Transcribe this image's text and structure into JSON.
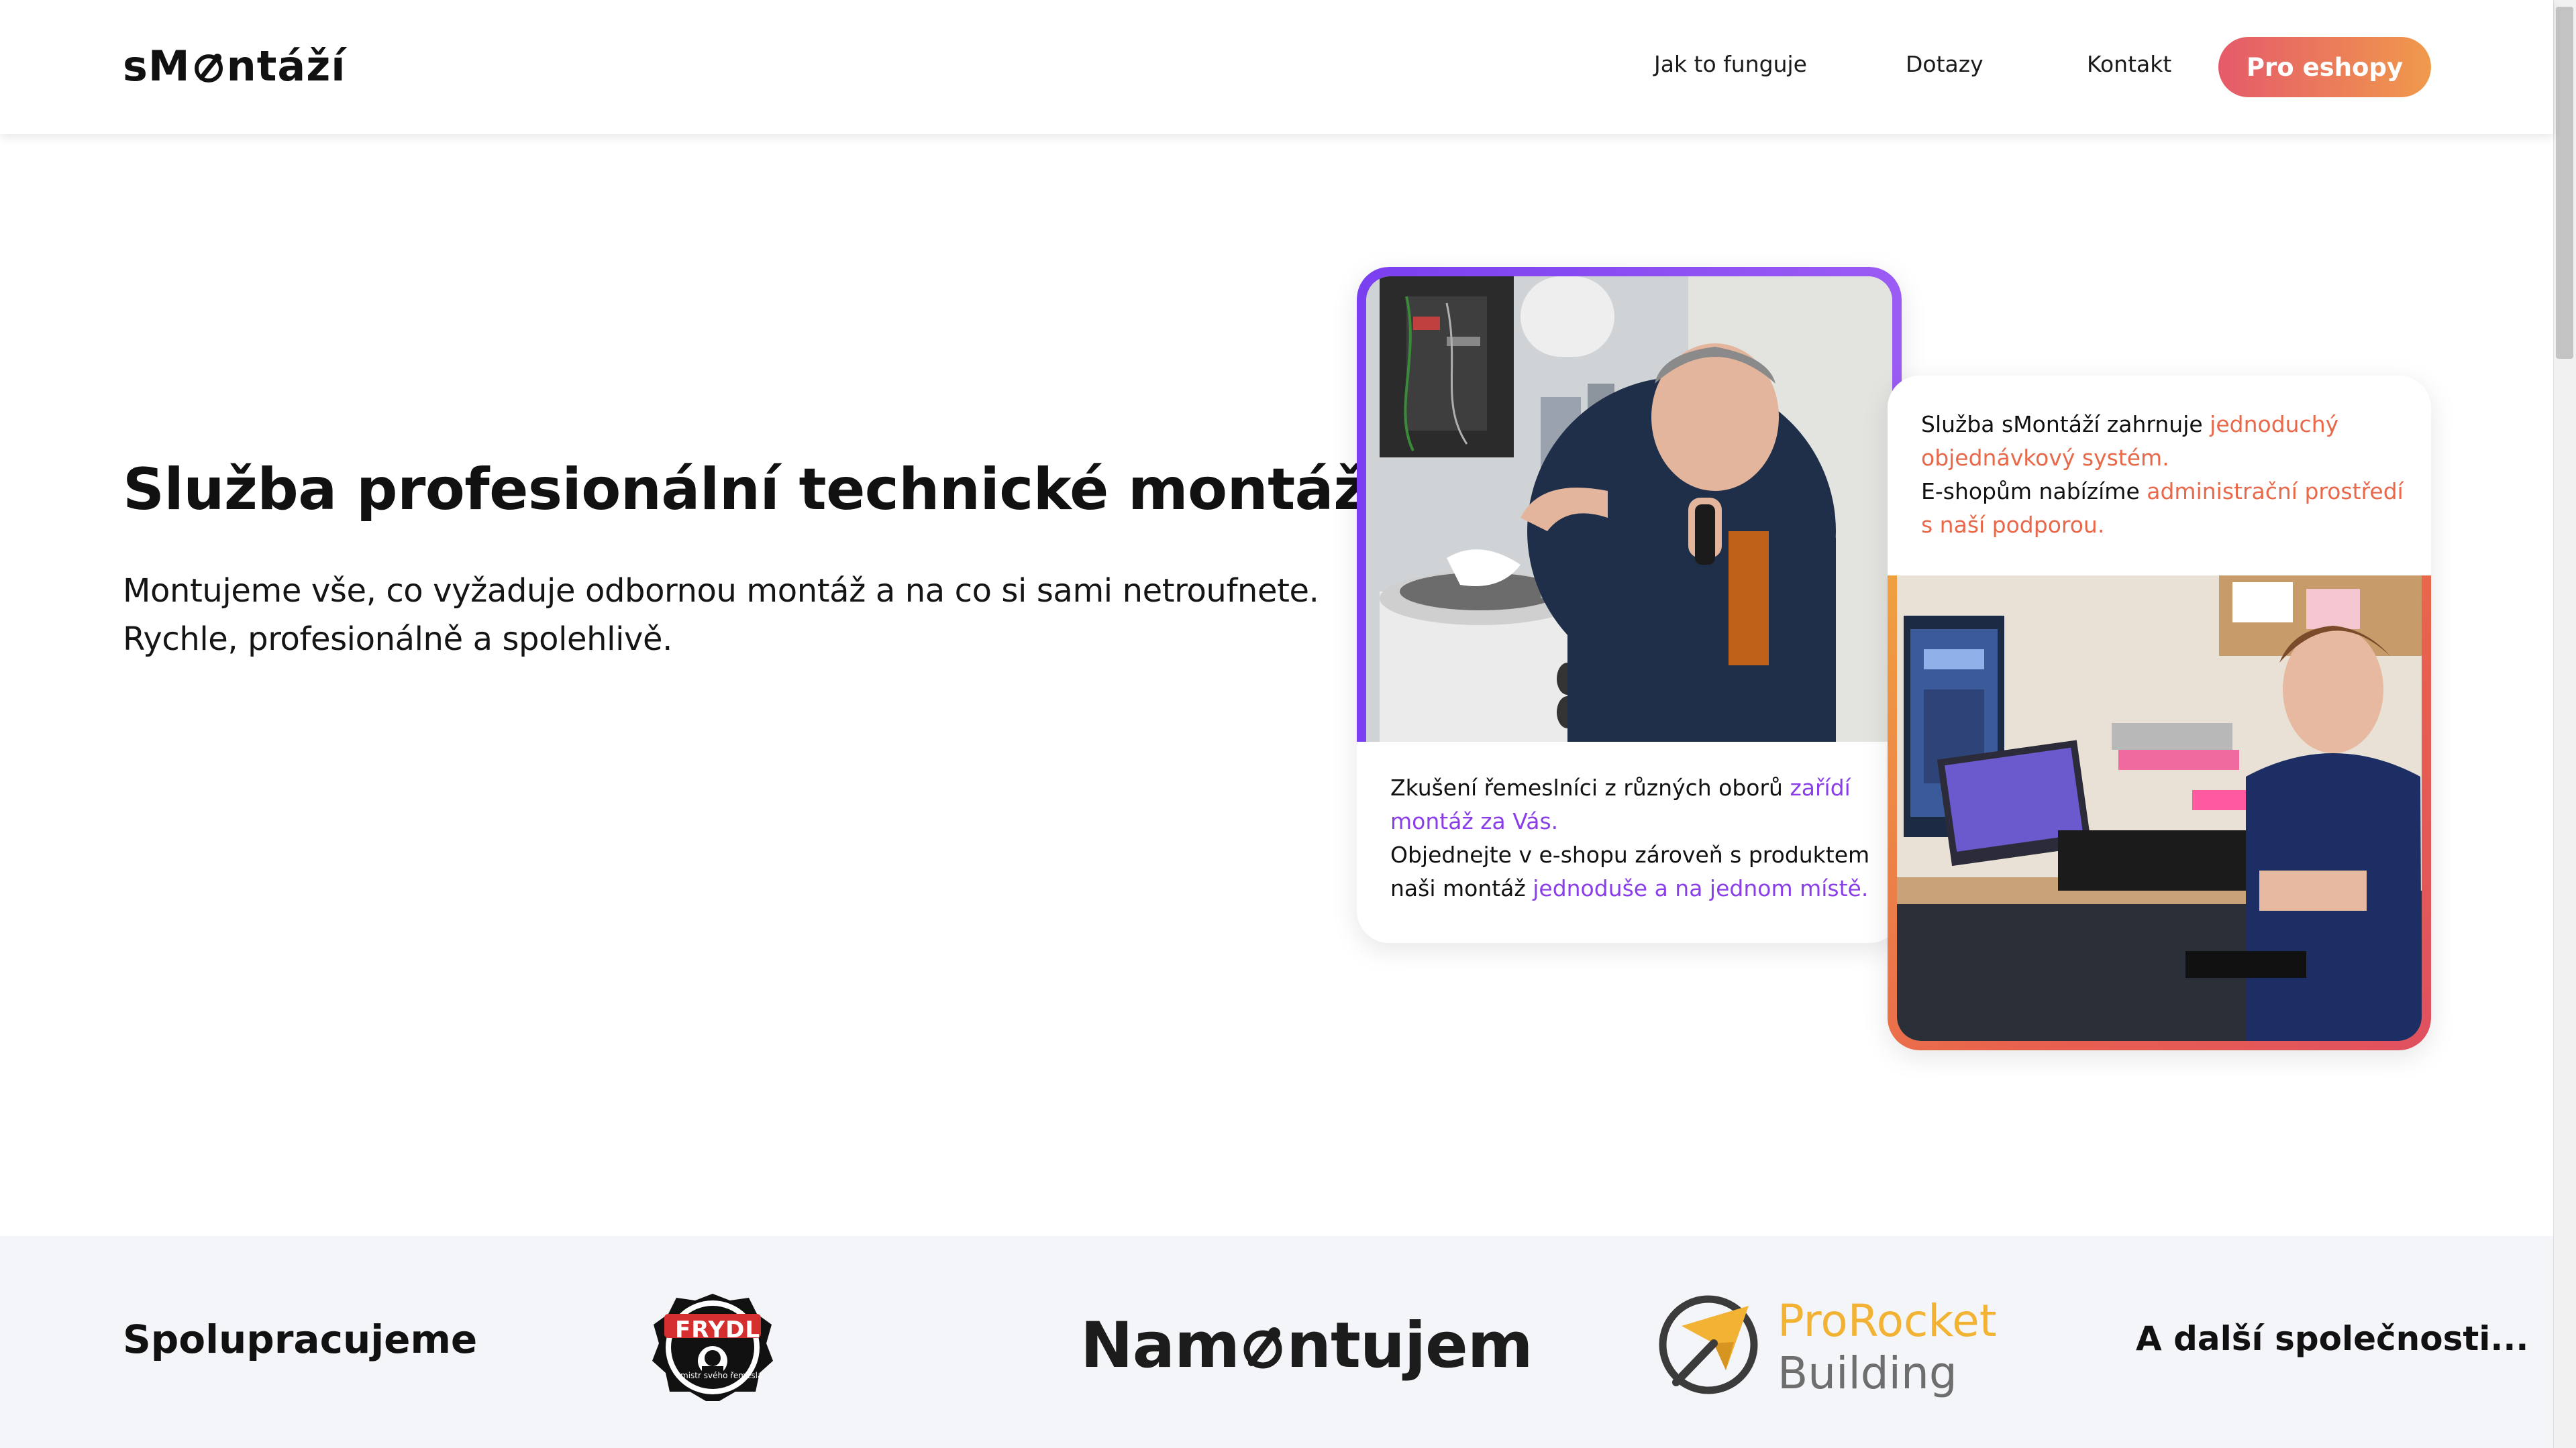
{
  "header": {
    "logo": {
      "before": "sM",
      "after": "ntáží"
    },
    "nav": [
      {
        "label": "Jak to funguje"
      },
      {
        "label": "Dotazy"
      },
      {
        "label": "Kontakt"
      }
    ],
    "cta_label": "Pro eshopy"
  },
  "hero": {
    "title": "Služba profesionální technické montáže",
    "subtitle_line1": "Montujeme vše, co vyžaduje odbornou montáž a na co si sami netroufnete.",
    "subtitle_line2": "Rychle, profesionálně a spolehlivě."
  },
  "card_left": {
    "image_alt": "Řemeslník montuje kotel a telefonuje",
    "p1_plain": "Zkušení řemeslníci z různých oborů ",
    "p1_accent": "zařídí montáž za Vás.",
    "p2_plain": "Objednejte v e-shopu zároveň s produktem naši montáž ",
    "p2_accent": "jednoduše a na jednom místě."
  },
  "card_right": {
    "p1_plain": "Služba sMontáží zahrnuje ",
    "p1_accent": "jednoduchý objednávkový systém.",
    "p2_plain": "E-shopům nabízíme ",
    "p2_accent": "administrační prostředí s naší podporou.",
    "image_alt": "Pracovnice podpory u počítače"
  },
  "partners": {
    "title": "Spolupracujeme",
    "more": "A další společnosti...",
    "frydl": {
      "name": "FRYDL",
      "tagline": "mistr svého řemesla"
    },
    "namontujem": {
      "before": "Nam",
      "after": "ntujem"
    },
    "prorocket": {
      "line1": "ProRocket",
      "line2": "Building"
    }
  },
  "colors": {
    "cta_gradient_start": "#e55a6a",
    "cta_gradient_end": "#f09a4c",
    "accent_purple": "#8a3ee8",
    "accent_orange": "#e8684a",
    "partners_bg": "#f3f5f8"
  }
}
